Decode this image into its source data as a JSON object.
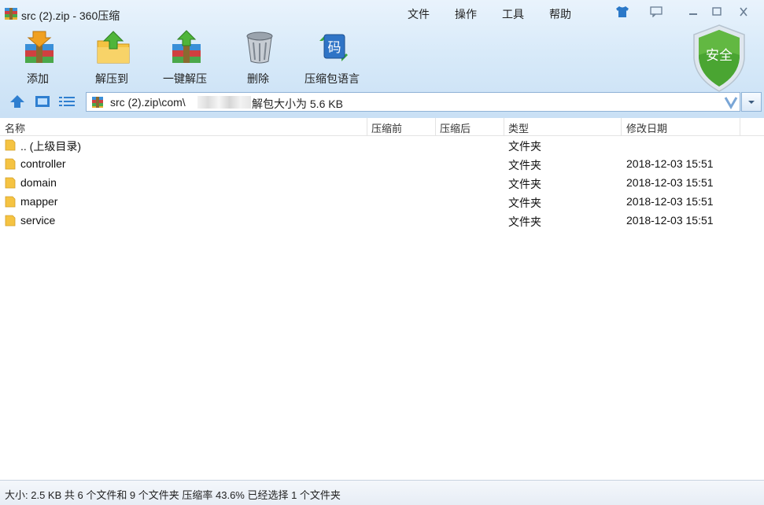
{
  "window": {
    "title": "src (2).zip - 360压缩",
    "icon": "archive-icon"
  },
  "menu": [
    "文件",
    "操作",
    "工具",
    "帮助"
  ],
  "window_controls": [
    "skin-icon",
    "feedback-icon",
    "minimize-icon",
    "maximize-icon",
    "close-icon"
  ],
  "toolbar": {
    "items": [
      {
        "label": "添加",
        "icon": "add-archive-icon"
      },
      {
        "label": "解压到",
        "icon": "extract-to-icon"
      },
      {
        "label": "一键解压",
        "icon": "one-click-extract-icon"
      },
      {
        "label": "删除",
        "icon": "trash-bin-icon"
      },
      {
        "label": "压缩包语言",
        "icon": "archive-language-icon"
      }
    ],
    "security_badge": "安全"
  },
  "address_bar": {
    "path": "src (2).zip\\com\\",
    "size_info": "解包大小为 5.6 KB"
  },
  "columns": [
    "名称",
    "压缩前",
    "压缩后",
    "类型",
    "修改日期"
  ],
  "files": [
    {
      "name": ".. (上级目录)",
      "type": "文件夹",
      "date": ""
    },
    {
      "name": "controller",
      "type": "文件夹",
      "date": "2018-12-03 15:51"
    },
    {
      "name": "domain",
      "type": "文件夹",
      "date": "2018-12-03 15:51"
    },
    {
      "name": "mapper",
      "type": "文件夹",
      "date": "2018-12-03 15:51"
    },
    {
      "name": "service",
      "type": "文件夹",
      "date": "2018-12-03 15:51"
    }
  ],
  "status": "大小: 2.5 KB 共 6 个文件和 9 个文件夹 压缩率 43.6% 已经选择 1 个文件夹",
  "colors": {
    "chrome_top": "#e9f3fc",
    "chrome_bottom": "#c9e0f5",
    "folder": "#f5c342",
    "shield": "#3f9a2c"
  }
}
